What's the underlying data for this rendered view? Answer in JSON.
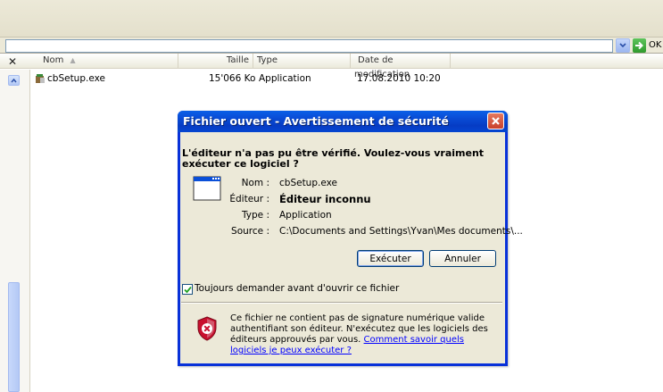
{
  "explorer": {
    "go_label": "OK",
    "columns": {
      "name": "Nom",
      "size": "Taille",
      "type": "Type",
      "modified": "Date de modification"
    },
    "file": {
      "name": "cbSetup.exe",
      "size": "15'066 Ko",
      "type": "Application",
      "modified": "17.08.2010 10:20"
    },
    "icons": {
      "close": "close-x-icon",
      "sort": "sort-ascending-icon",
      "scroll_up": "scroll-up-icon",
      "go": "go-arrow-icon",
      "dropdown": "chevron-down-icon"
    }
  },
  "dialog": {
    "title": "Fichier ouvert - Avertissement de sécurité",
    "question": "L'éditeur n'a pas pu être vérifié. Voulez-vous vraiment exécuter ce logiciel ?",
    "fields": {
      "name_label": "Nom :",
      "name_value": "cbSetup.exe",
      "publisher_label": "Éditeur :",
      "publisher_value": "Éditeur inconnu",
      "type_label": "Type :",
      "type_value": "Application",
      "source_label": "Source :",
      "source_value": "C:\\Documents and Settings\\Yvan\\Mes documents\\..."
    },
    "buttons": {
      "run": "Exécuter",
      "cancel": "Annuler"
    },
    "checkbox": {
      "label": "Toujours demander avant d'ouvrir ce fichier",
      "checked": true
    },
    "info": {
      "text": "Ce fichier ne contient pas de signature numérique valide authentifiant son éditeur. N'exécutez que les logiciels des éditeurs approuvés par vous.",
      "link": "Comment savoir quels logiciels je peux exécuter ?"
    }
  },
  "colors": {
    "titlebar": "#0a4fd8",
    "window_face": "#ece9d8",
    "link": "#0000ff",
    "close_button": "#d5553f",
    "shield_red": "#c8102e"
  }
}
